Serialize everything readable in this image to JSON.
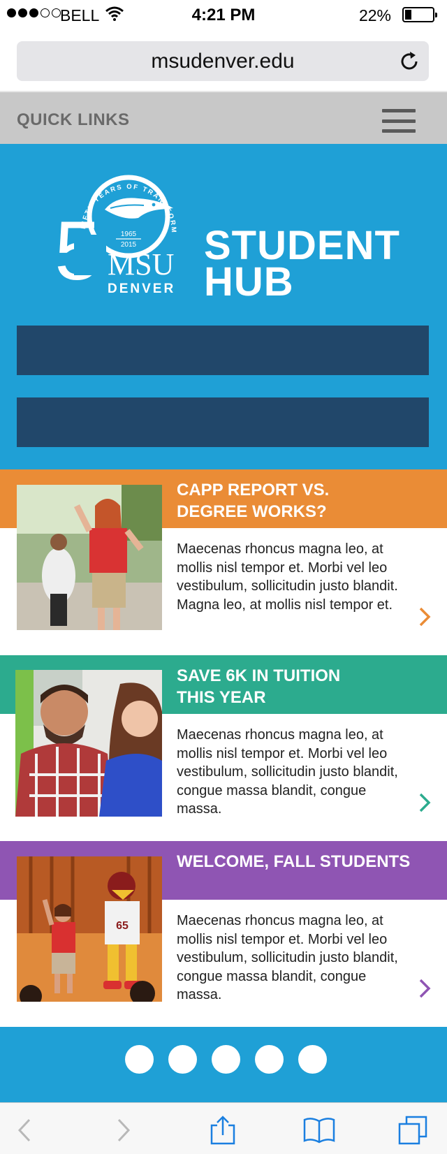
{
  "status_bar": {
    "carrier": "BELL",
    "time": "4:21 PM",
    "battery": "22%",
    "battery_level": 0.22,
    "signal_bars": 3,
    "signal_max": 5
  },
  "browser": {
    "url": "msudenver.edu",
    "reload_icon": "reload-icon"
  },
  "quick_links": {
    "label": "QUICK LINKS",
    "menu_icon": "hamburger-menu-icon"
  },
  "hero": {
    "logo_text": {
      "ring": "FIFTY YEARS OF TRANSFORMING LIVES",
      "years_start": "1965",
      "years_end": "2015",
      "number": "5",
      "brand": "MSU",
      "brand_sub": "DENVER"
    },
    "title_line1": "STUDENT",
    "title_line2": "HUB"
  },
  "cards": [
    {
      "heading_line1": "CAPP REPORT VS.",
      "heading_line2": "DEGREE WORKS?",
      "body": "Maecenas rhoncus magna leo, at mollis nisl tempor et. Morbi vel leo vestibulum, sollicitudin justo blandit. Magna leo, at mollis nisl tempor et.",
      "accent": "#ea8c36"
    },
    {
      "heading_line1": "SAVE 6K IN TUITION",
      "heading_line2": "THIS YEAR",
      "body": "Maecenas rhoncus magna leo, at mollis nisl tempor et. Morbi vel leo vestibulum, sollicitudin justo blandit, congue massa blandit, congue massa.",
      "accent": "#2cab8e"
    },
    {
      "heading_line1": "WELCOME, FALL STUDENTS",
      "heading_line2": "",
      "body": "Maecenas rhoncus magna leo, at mollis nisl tempor et. Morbi vel leo vestibulum, sollicitudin justo blandit, congue massa blandit, congue massa.",
      "accent": "#8f55b3"
    }
  ],
  "pager": {
    "count": 5
  },
  "toolbar": {
    "icons": [
      "back-icon",
      "forward-icon",
      "share-icon",
      "bookmarks-icon",
      "tabs-icon"
    ]
  },
  "colors": {
    "hero_blue": "#1fa0d6",
    "cta_navy": "#21476a",
    "quick_links_gray": "#c8c8c8"
  }
}
